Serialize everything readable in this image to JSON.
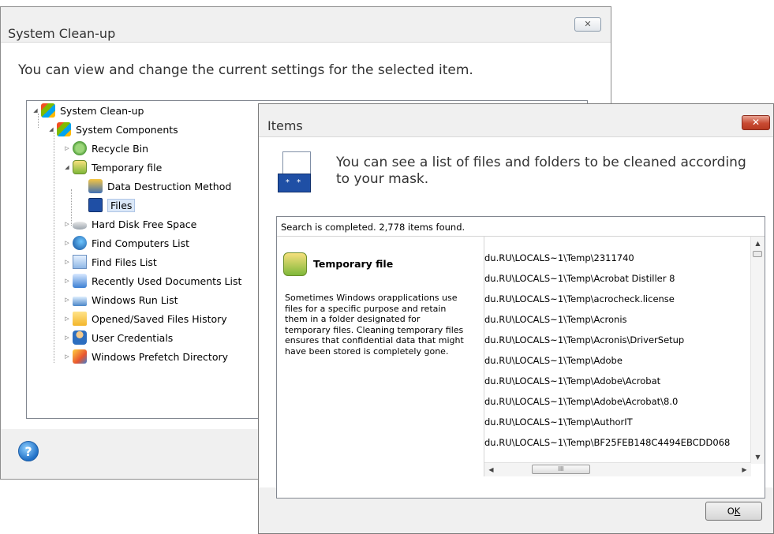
{
  "background_dialog": {
    "title": "System Clean-up",
    "close_label": "✕",
    "description": "You can view and change the current settings for the selected item.",
    "help_label": "?",
    "tree": [
      {
        "label": "System Clean-up",
        "icon": "system-cleanup-icon",
        "expanded": true
      },
      {
        "label": "System Components",
        "icon": "system-components-icon",
        "expanded": true
      },
      {
        "label": "Recycle Bin",
        "icon": "recycle-bin-icon",
        "expanded": false
      },
      {
        "label": "Temporary file",
        "icon": "temporary-file-icon",
        "expanded": true
      },
      {
        "label": "Data Destruction Method",
        "icon": "data-destruction-icon"
      },
      {
        "label": "Files",
        "icon": "files-icon",
        "selected": true
      },
      {
        "label": "Hard Disk Free Space",
        "icon": "hard-disk-icon",
        "expanded": false
      },
      {
        "label": "Find Computers List",
        "icon": "find-computers-icon",
        "expanded": false
      },
      {
        "label": "Find Files List",
        "icon": "find-files-icon",
        "expanded": false
      },
      {
        "label": "Recently Used Documents List",
        "icon": "recent-documents-icon",
        "expanded": false
      },
      {
        "label": "Windows Run List",
        "icon": "run-list-icon",
        "expanded": false
      },
      {
        "label": "Opened/Saved Files History",
        "icon": "folder-history-icon",
        "expanded": false
      },
      {
        "label": "User Credentials",
        "icon": "user-credentials-icon",
        "expanded": false
      },
      {
        "label": "Windows Prefetch Directory",
        "icon": "prefetch-icon",
        "expanded": false
      }
    ]
  },
  "items_dialog": {
    "title": "Items",
    "close_label": "✕",
    "icon_text": "* *",
    "description": "You can see a list of files and folders to be cleaned according to your mask.",
    "status": "Search is completed. 2,778 items found.",
    "category": {
      "title": "Temporary file",
      "description": "Sometimes Windows orapplications use files for a specific purpose and retain them in a folder designated for temporary files. Cleaning temporary files ensures that confidential data that might have been stored is completely gone."
    },
    "files": [
      "du.RU\\LOCALS~1\\Temp\\2311740",
      "du.RU\\LOCALS~1\\Temp\\Acrobat Distiller 8",
      "du.RU\\LOCALS~1\\Temp\\acrocheck.license",
      "du.RU\\LOCALS~1\\Temp\\Acronis",
      "du.RU\\LOCALS~1\\Temp\\Acronis\\DriverSetup",
      "du.RU\\LOCALS~1\\Temp\\Adobe",
      "du.RU\\LOCALS~1\\Temp\\Adobe\\Acrobat",
      "du.RU\\LOCALS~1\\Temp\\Adobe\\Acrobat\\8.0",
      "du.RU\\LOCALS~1\\Temp\\AuthorIT",
      "du.RU\\LOCALS~1\\Temp\\BF25FEB148C4494EBCDD068"
    ],
    "scroll_thumb_grip": "III",
    "ok_label_prefix": "O",
    "ok_label_underlined": "K"
  }
}
